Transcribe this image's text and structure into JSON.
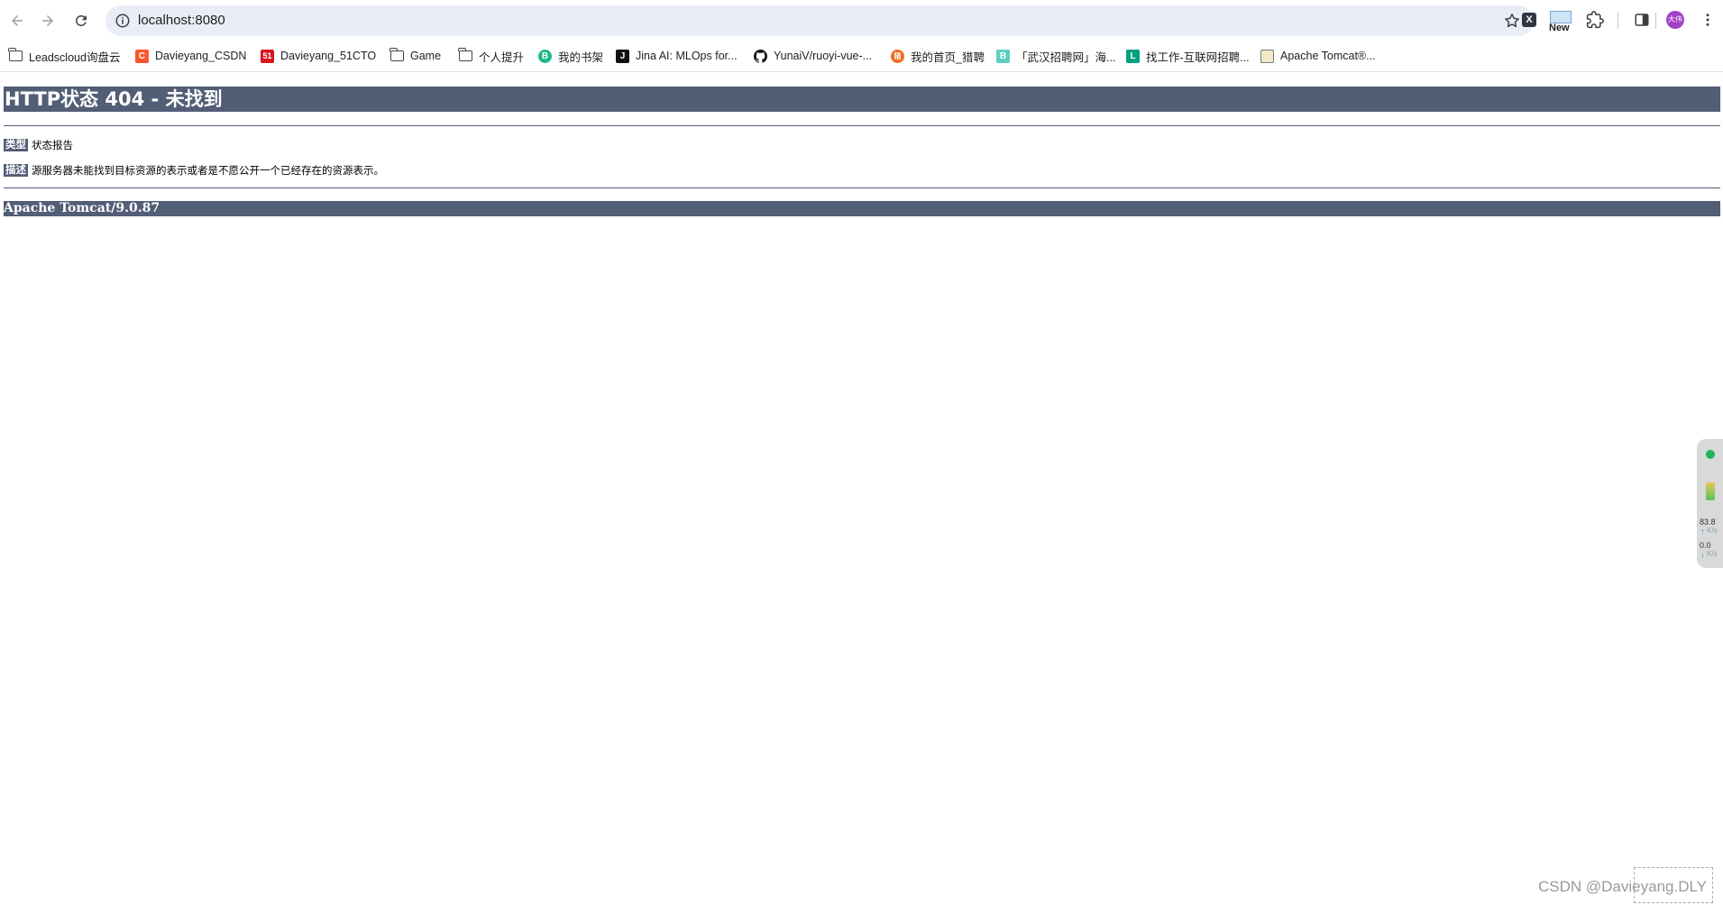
{
  "browser": {
    "url": "localhost:8080",
    "new_badge_label": "New",
    "avatar_text": "大伟"
  },
  "bookmarks": [
    {
      "label": "Leadscloud询盘云",
      "icon": "folder-icon"
    },
    {
      "label": "Davieyang_CSDN",
      "icon": "csdn-icon",
      "glyph": "C"
    },
    {
      "label": "Davieyang_51CTO",
      "icon": "51cto-icon",
      "glyph": "51"
    },
    {
      "label": "Game",
      "icon": "folder-icon"
    },
    {
      "label": "个人提升",
      "icon": "folder-icon"
    },
    {
      "label": "我的书架",
      "icon": "book-icon",
      "glyph": "B"
    },
    {
      "label": "Jina AI: MLOps for...",
      "icon": "jina-icon",
      "glyph": "J"
    },
    {
      "label": "YunaiV/ruoyi-vue-...",
      "icon": "github-icon"
    },
    {
      "label": "我的首页_猎聘",
      "icon": "liepin-icon",
      "glyph": "猎"
    },
    {
      "label": "「武汉招聘网」海...",
      "icon": "boss-icon",
      "glyph": "B"
    },
    {
      "label": "找工作-互联网招聘...",
      "icon": "lagou-icon",
      "glyph": "L"
    },
    {
      "label": "Apache Tomcat®...",
      "icon": "tomcat-icon"
    }
  ],
  "page": {
    "title": "HTTP状态 404 - 未找到",
    "type_key": "类型",
    "type_value": "状态报告",
    "desc_key": "描述",
    "desc_value": "源服务器未能找到目标资源的表示或者是不愿公开一个已经存在的资源表示。",
    "server": "Apache Tomcat/9.0.87"
  },
  "side_widget": {
    "upload_value": "83.8",
    "upload_unit": "K/s",
    "download_value": "0.0",
    "download_unit": "K/s"
  },
  "watermark": "CSDN @Davieyang.DLY",
  "colors": {
    "tomcat_bar": "#525d76",
    "omnibox_bg": "#e9eef6",
    "status_green": "#1fb45c"
  }
}
